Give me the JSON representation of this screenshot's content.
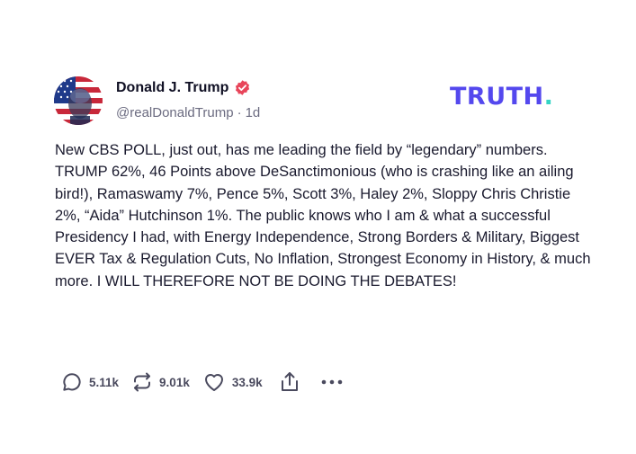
{
  "author": {
    "display_name": "Donald J. Trump",
    "handle": "@realDonaldTrump",
    "separator": "·",
    "time_ago": "1d",
    "verified": true,
    "verified_color": "#e8455a"
  },
  "brand": {
    "logo_text": "TRUTH",
    "logo_dot": ".",
    "logo_color": "#5448ee",
    "dot_color": "#34d4c4"
  },
  "post": {
    "text": "New CBS POLL, just out, has me leading the field by “legendary” numbers. TRUMP 62%, 46 Points above DeSanctimonious (who is crashing like an ailing bird!), Ramaswamy 7%, Pence 5%, Scott 3%, Haley 2%, Sloppy Chris Christie 2%, “Aida” Hutchinson 1%. The public knows who I am & what a successful Presidency I had, with Energy Independence, Strong Borders & Military, Biggest EVER Tax & Regulation Cuts, No Inflation, Strongest Economy in History, & much more. I WILL THEREFORE NOT BE DOING THE DEBATES!"
  },
  "actions": {
    "replies": "5.11k",
    "retruths": "9.01k",
    "likes": "33.9k",
    "icons": [
      "reply-icon",
      "retruth-icon",
      "like-icon",
      "share-icon",
      "more-icon"
    ]
  }
}
